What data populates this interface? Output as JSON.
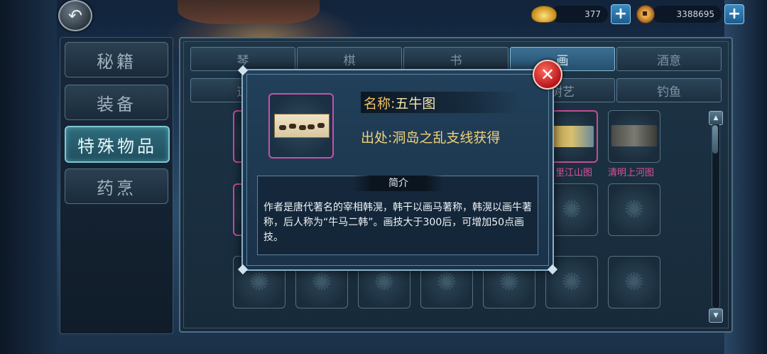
{
  "header": {
    "gold_amount": "377",
    "copper_amount": "3388695"
  },
  "icons": {
    "back": "back-arrow-icon",
    "gold": "gold-ingot-icon",
    "copper": "copper-coin-icon",
    "plus": "plus-icon",
    "close": "close-x-icon"
  },
  "sidebar": {
    "items": [
      {
        "label": "秘籍",
        "active": false
      },
      {
        "label": "装备",
        "active": false
      },
      {
        "label": "特殊物品",
        "active": true
      },
      {
        "label": "药烹",
        "active": false
      }
    ]
  },
  "tabs": {
    "row1": [
      "琴",
      "棋",
      "书",
      "画",
      "酒意"
    ],
    "row2": [
      "道",
      "",
      "",
      "树艺",
      "钓鱼"
    ],
    "active": "画"
  },
  "grid": {
    "visible_labels": [
      "里江山图",
      "清明上河图"
    ]
  },
  "popup": {
    "name_label": "名称:",
    "name_value": "五牛图",
    "source_label": "出处:",
    "source_value": "洞岛之乱支线获得",
    "intro_title": "简介",
    "intro_text": "作者是唐代著名的宰相韩滉，韩干以画马著称，韩滉以画牛著称，后人称为“牛马二韩”。画技大于300后，可增加50点画技。"
  },
  "colors": {
    "accent_gold": "#f0c060",
    "label_pink": "#e0509a",
    "close_red": "#c51a20",
    "selected_border": "#c850a8"
  }
}
